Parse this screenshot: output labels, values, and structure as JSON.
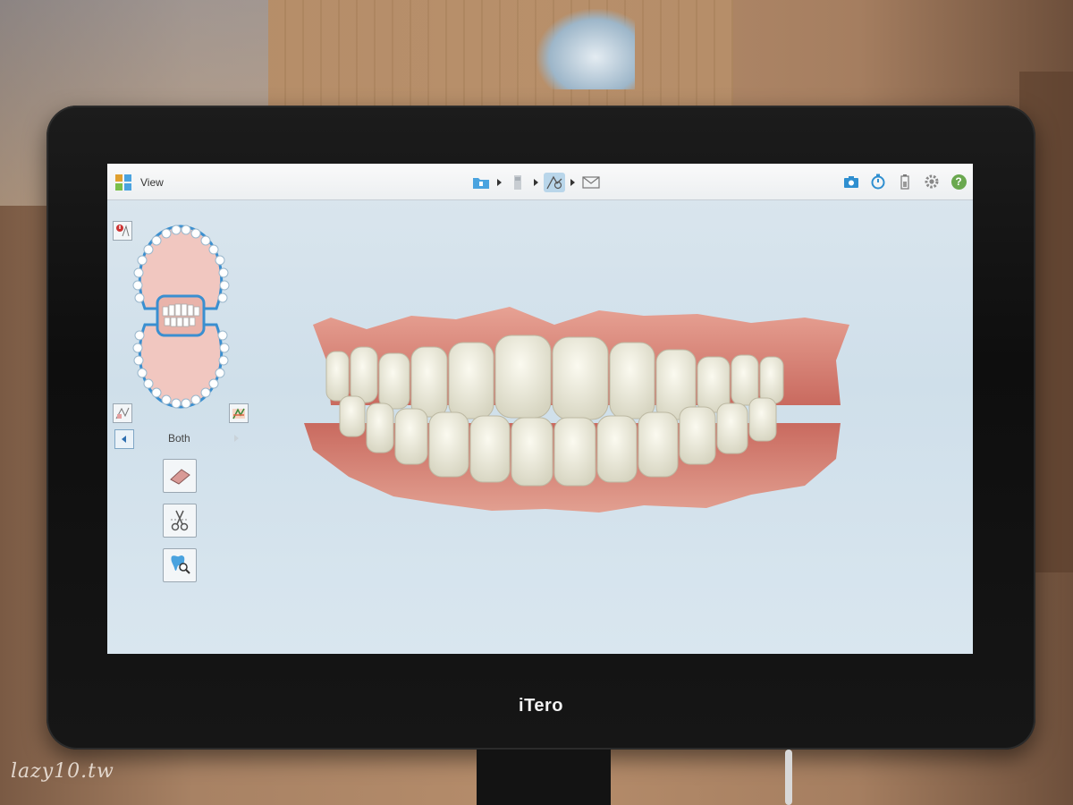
{
  "app": {
    "title": "View",
    "brand": "iTero"
  },
  "workflow": {
    "steps": [
      {
        "name": "patient",
        "icon": "folder-icon",
        "active": false
      },
      {
        "name": "scan",
        "icon": "scanner-icon",
        "active": false
      },
      {
        "name": "view",
        "icon": "view-tool-icon",
        "active": true
      },
      {
        "name": "send",
        "icon": "envelope-icon",
        "active": false
      }
    ]
  },
  "toolbar": {
    "icons": [
      "camera-icon",
      "stopwatch-icon",
      "battery-icon",
      "gear-icon",
      "help-icon"
    ],
    "help_label": "?"
  },
  "sidebar": {
    "jaw_selection": "Both",
    "tools": [
      "eraser-icon",
      "scissors-icon",
      "tooth-magnifier-icon"
    ]
  },
  "colors": {
    "accent": "#2f8fd0",
    "help_green": "#6aa84f",
    "gum": "#c96a5f",
    "teeth": "#e8e6d8"
  },
  "watermark": "lazy10.tw"
}
